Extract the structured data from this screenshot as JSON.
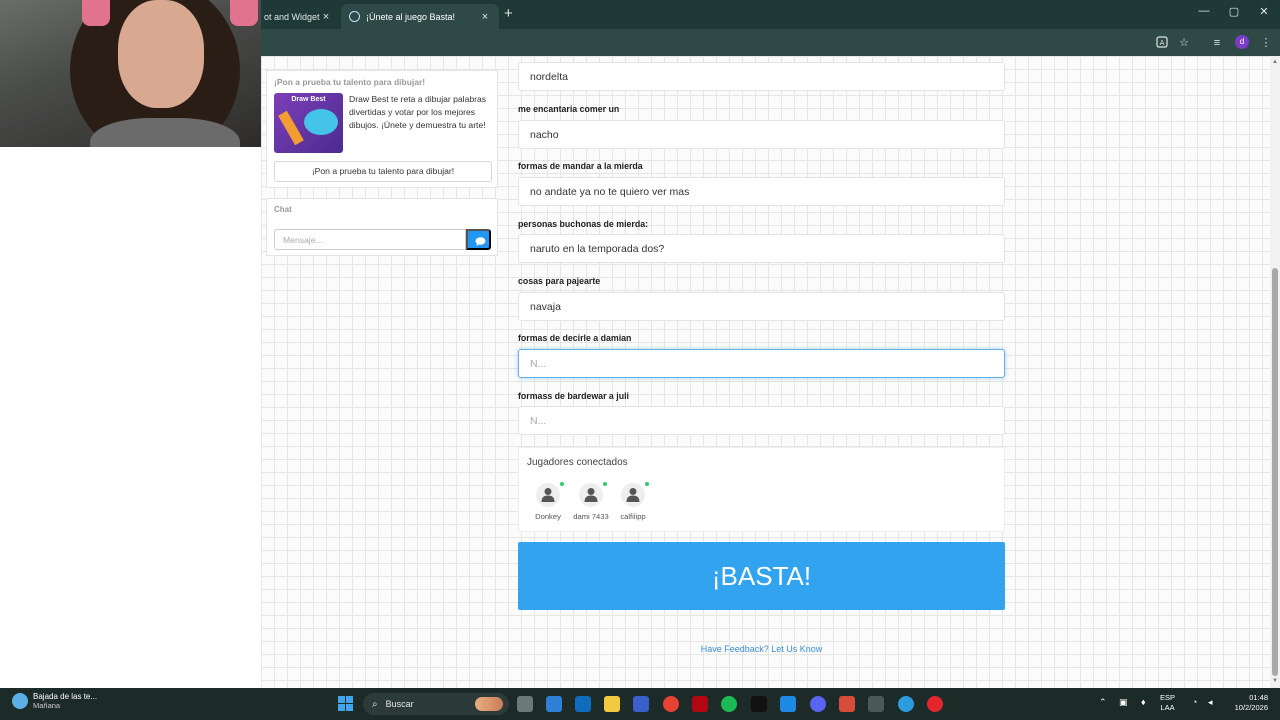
{
  "browser": {
    "tabs": [
      {
        "title": "ot and Widgets",
        "active": false
      },
      {
        "title": "¡Únete al juego Basta!",
        "active": true
      }
    ],
    "new_tab_symbol": "+",
    "close_symbol": "×",
    "profile_initial": "d",
    "window_controls": {
      "minimize": "—",
      "maximize": "▢",
      "close": "✕"
    }
  },
  "promo": {
    "heading": "¡Pon a prueba tu talento para dibujar!",
    "image_title": "Draw Best",
    "description": "Draw Best te reta a dibujar palabras divertidas y votar por los mejores dibujos. ¡Únete y demuestra tu arte!",
    "button_label": "¡Pon a prueba tu talento para dibujar!"
  },
  "chat": {
    "heading": "Chat",
    "placeholder": "Mensaje..."
  },
  "form": {
    "first_value": "nordelta",
    "fields": [
      {
        "label": "me encantaria comer un",
        "value": "nacho"
      },
      {
        "label": "formas de mandar a la mierda",
        "value": "no andate ya no te quiero ver mas"
      },
      {
        "label": "personas buchonas de mierda:",
        "value": "naruto en la temporada dos?"
      },
      {
        "label": "cosas para pajearte",
        "value": "navaja"
      },
      {
        "label": "formas de decirle a damian",
        "value": "",
        "placeholder": "N..."
      },
      {
        "label": "formass de bardewar a juli",
        "value": "",
        "placeholder": "N..."
      }
    ]
  },
  "players": {
    "title": "Jugadores conectados",
    "list": [
      {
        "name": "Donkey",
        "online": true
      },
      {
        "name": "dami 7433",
        "online": true
      },
      {
        "name": "calfilipp",
        "online": true
      }
    ]
  },
  "basta_label": "¡BASTA!",
  "feedback_link": "Have Feedback? Let Us Know",
  "taskbar": {
    "weather_line1": "Bajada de las te...",
    "weather_line2": "Mañana",
    "search_label": "Buscar",
    "language_line1": "ESP",
    "language_line2": "LAA",
    "time": "01:48",
    "date": "10/2/2026"
  },
  "colors": {
    "accent": "#31a3ef",
    "chrome_dark": "#1f3a36",
    "online_dot": "#2ecc71",
    "link": "#3a8fd6"
  }
}
